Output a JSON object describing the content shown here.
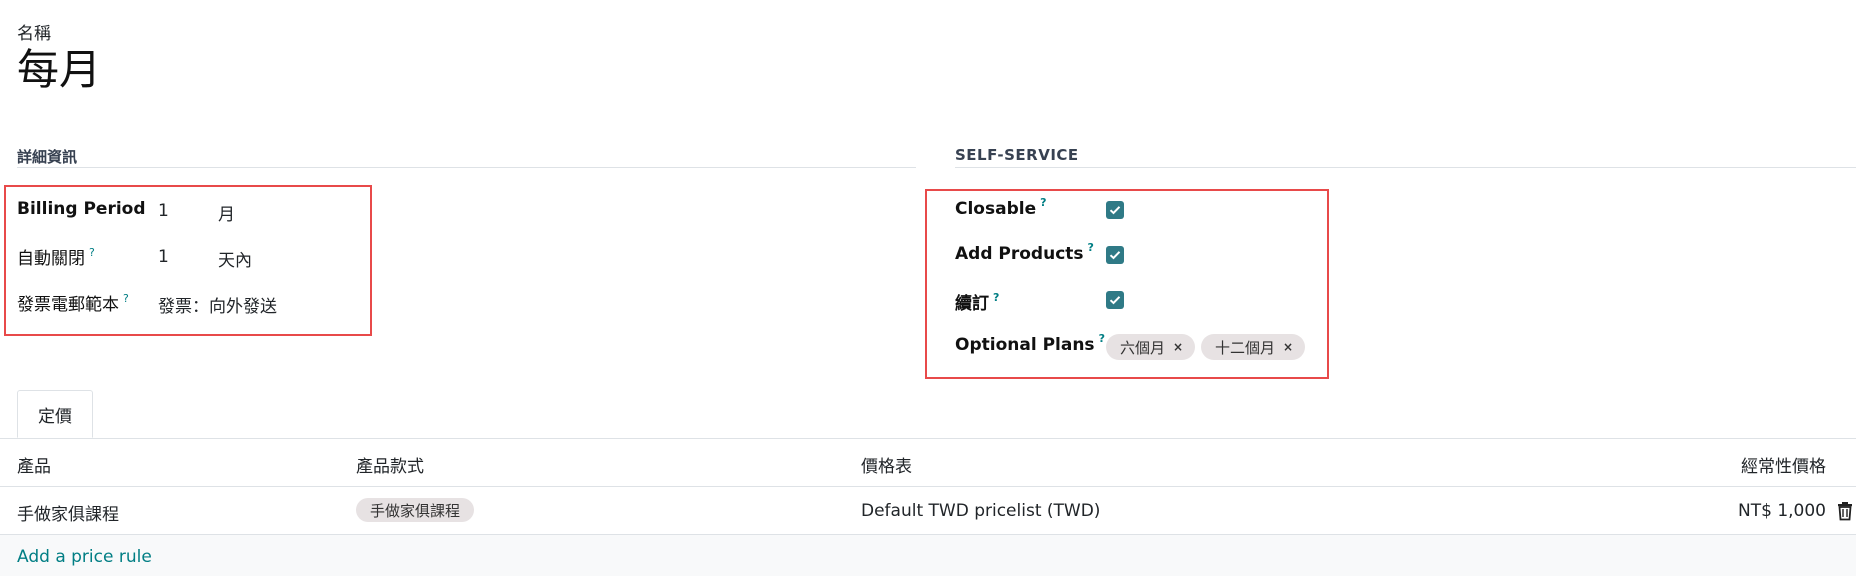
{
  "header": {
    "name_label": "名稱",
    "name_value": "每月"
  },
  "details": {
    "section_title": "詳細資訊",
    "billing_period": {
      "label": "Billing Period",
      "value": "1",
      "unit": "月"
    },
    "auto_close": {
      "label": "自動關閉",
      "help": "?",
      "value": "1",
      "unit": "天內"
    },
    "invoice_mail_template": {
      "label": "發票電郵範本",
      "help": "?",
      "value": "發票：向外發送"
    }
  },
  "self_service": {
    "section_title": "SELF-SERVICE",
    "closable": {
      "label": "Closable",
      "help": "?",
      "checked": true
    },
    "add_products": {
      "label": "Add Products",
      "help": "?",
      "checked": true
    },
    "renew": {
      "label": "續訂",
      "help": "?",
      "checked": true
    },
    "optional_plans": {
      "label": "Optional Plans",
      "help": "?",
      "tags": [
        "六個月",
        "十二個月"
      ],
      "remove_glyph": "×"
    }
  },
  "tabs": [
    {
      "label": "定價",
      "active": true
    }
  ],
  "pricing_table": {
    "headers": {
      "product": "產品",
      "variant": "產品款式",
      "pricelist": "價格表",
      "recurring_price": "經常性價格"
    },
    "rows": [
      {
        "product": "手做家俱課程",
        "variant": "手做家俱課程",
        "pricelist": "Default TWD pricelist (TWD)",
        "price": "NT$ 1,000"
      }
    ],
    "add_line_label": "Add a price rule"
  },
  "colors": {
    "highlight_border": "#e84a4a",
    "checkbox_fill": "#2f7a86",
    "link": "#017e84",
    "tag_bg": "#e7e2e3"
  },
  "icons": {
    "check": "check-icon",
    "trash": "trash-icon",
    "remove_tag": "close-icon"
  }
}
